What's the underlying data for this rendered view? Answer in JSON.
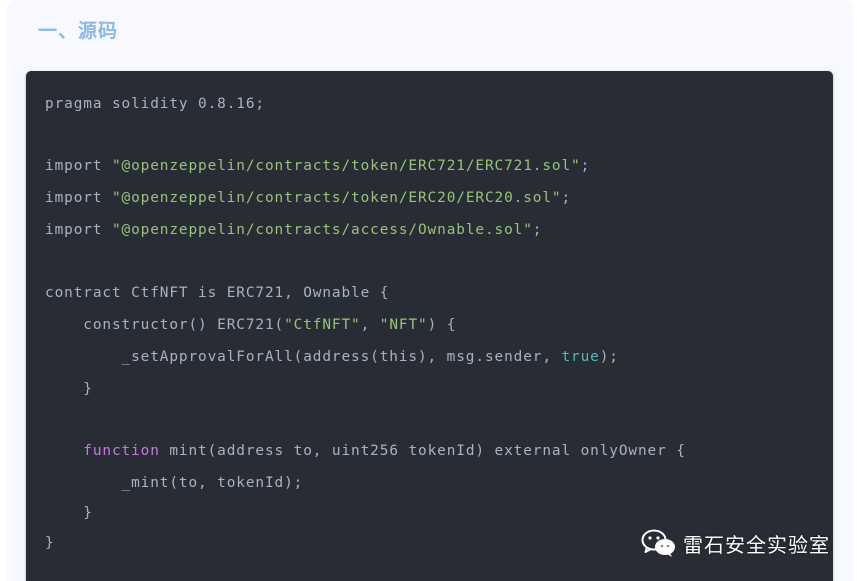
{
  "section": {
    "title": "一、源码"
  },
  "code": {
    "lines": [
      [
        {
          "t": "pragma solidity 0.8.16;",
          "c": "plain"
        }
      ],
      [],
      [
        {
          "t": "import ",
          "c": "plain"
        },
        {
          "t": "\"@openzeppelin/contracts/token/ERC721/ERC721.sol\"",
          "c": "string"
        },
        {
          "t": ";",
          "c": "plain"
        }
      ],
      [
        {
          "t": "import ",
          "c": "plain"
        },
        {
          "t": "\"@openzeppelin/contracts/token/ERC20/ERC20.sol\"",
          "c": "string"
        },
        {
          "t": ";",
          "c": "plain"
        }
      ],
      [
        {
          "t": "import ",
          "c": "plain"
        },
        {
          "t": "\"@openzeppelin/contracts/access/Ownable.sol\"",
          "c": "string"
        },
        {
          "t": ";",
          "c": "plain"
        }
      ],
      [],
      [
        {
          "t": "contract CtfNFT is ERC721, Ownable {",
          "c": "plain"
        }
      ],
      [
        {
          "t": "    constructor() ERC721(",
          "c": "plain"
        },
        {
          "t": "\"CtfNFT\"",
          "c": "string"
        },
        {
          "t": ", ",
          "c": "plain"
        },
        {
          "t": "\"NFT\"",
          "c": "string"
        },
        {
          "t": ") {",
          "c": "plain"
        }
      ],
      [
        {
          "t": "        _setApprovalForAll(address(this), msg.sender, ",
          "c": "plain"
        },
        {
          "t": "true",
          "c": "literal"
        },
        {
          "t": ");",
          "c": "plain"
        }
      ],
      [
        {
          "t": "    }",
          "c": "plain"
        }
      ],
      [],
      [
        {
          "t": "    ",
          "c": "plain"
        },
        {
          "t": "function",
          "c": "keyword"
        },
        {
          "t": " mint(address to, uint256 tokenId) external onlyOwner {",
          "c": "plain"
        }
      ],
      [
        {
          "t": "        _mint(to, tokenId);",
          "c": "plain"
        }
      ],
      [
        {
          "t": "    }",
          "c": "plain"
        }
      ],
      [
        {
          "t": "}",
          "c": "plain"
        }
      ]
    ]
  },
  "watermark": {
    "text": "雷石安全实验室",
    "icon": "wechat-icon"
  },
  "colors": {
    "title": "#8eb8e6",
    "code_bg": "#282c34",
    "plain": "#abb2bf",
    "string": "#98c379",
    "keyword": "#c678dd",
    "literal": "#56b6c2"
  }
}
